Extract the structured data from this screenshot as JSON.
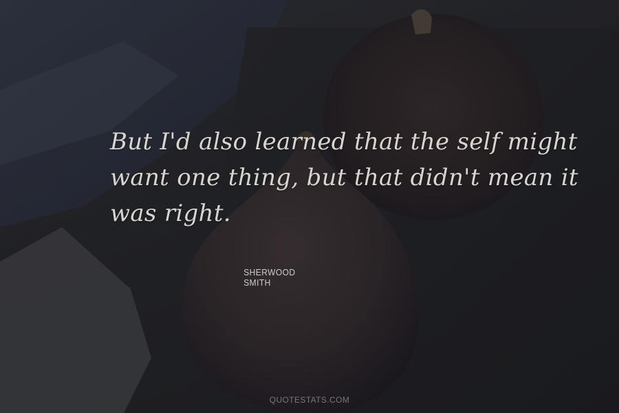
{
  "quote": {
    "lines": [
      "But I'd also learned that the self might",
      "want one thing, but that didn't mean it",
      "was right."
    ]
  },
  "author": "SHERWOOD SMITH",
  "watermark": "QUOTESTATS.COM",
  "colors": {
    "background": "#2b2c31",
    "fig": "#3b3336",
    "quote_text": "#d8d4d0",
    "watermark_text": "#77777e"
  }
}
